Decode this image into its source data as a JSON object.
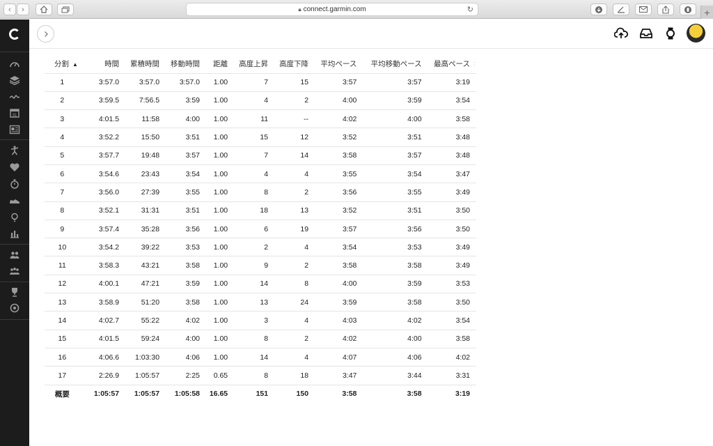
{
  "browser": {
    "url": "connect.garmin.com",
    "back_glyph": "‹",
    "forward_glyph": "›"
  },
  "sidebar": {
    "items": [
      {
        "icon": "dashboard-icon"
      },
      {
        "icon": "layers-icon"
      },
      {
        "icon": "activity-wave-icon"
      },
      {
        "icon": "calendar-icon"
      },
      {
        "icon": "news-icon"
      },
      {
        "icon": "run-person-icon"
      },
      {
        "icon": "heart-icon"
      },
      {
        "icon": "stopwatch-icon"
      },
      {
        "icon": "shoe-icon"
      },
      {
        "icon": "lightbulb-icon"
      },
      {
        "icon": "bar-chart-icon"
      },
      {
        "icon": "connections-icon"
      },
      {
        "icon": "groups-icon"
      },
      {
        "icon": "trophy-icon"
      },
      {
        "icon": "target-icon"
      }
    ]
  },
  "header": {
    "icons": [
      "upload-cloud-icon",
      "inbox-icon",
      "watch-icon",
      "avatar"
    ]
  },
  "table": {
    "columns": [
      "分割",
      "時間",
      "累積時間",
      "移動時間",
      "距離",
      "高度上昇",
      "高度下降",
      "平均ペース",
      "平均移動ペース",
      "最高ペース"
    ],
    "sort_indicator": "▲",
    "rows": [
      [
        "1",
        "3:57.0",
        "3:57.0",
        "3:57.0",
        "1.00",
        "7",
        "15",
        "3:57",
        "3:57",
        "3:19"
      ],
      [
        "2",
        "3:59.5",
        "7:56.5",
        "3:59",
        "1.00",
        "4",
        "2",
        "4:00",
        "3:59",
        "3:54"
      ],
      [
        "3",
        "4:01.5",
        "11:58",
        "4:00",
        "1.00",
        "11",
        "--",
        "4:02",
        "4:00",
        "3:58"
      ],
      [
        "4",
        "3:52.2",
        "15:50",
        "3:51",
        "1.00",
        "15",
        "12",
        "3:52",
        "3:51",
        "3:48"
      ],
      [
        "5",
        "3:57.7",
        "19:48",
        "3:57",
        "1.00",
        "7",
        "14",
        "3:58",
        "3:57",
        "3:48"
      ],
      [
        "6",
        "3:54.6",
        "23:43",
        "3:54",
        "1.00",
        "4",
        "4",
        "3:55",
        "3:54",
        "3:47"
      ],
      [
        "7",
        "3:56.0",
        "27:39",
        "3:55",
        "1.00",
        "8",
        "2",
        "3:56",
        "3:55",
        "3:49"
      ],
      [
        "8",
        "3:52.1",
        "31:31",
        "3:51",
        "1.00",
        "18",
        "13",
        "3:52",
        "3:51",
        "3:50"
      ],
      [
        "9",
        "3:57.4",
        "35:28",
        "3:56",
        "1.00",
        "6",
        "19",
        "3:57",
        "3:56",
        "3:50"
      ],
      [
        "10",
        "3:54.2",
        "39:22",
        "3:53",
        "1.00",
        "2",
        "4",
        "3:54",
        "3:53",
        "3:49"
      ],
      [
        "11",
        "3:58.3",
        "43:21",
        "3:58",
        "1.00",
        "9",
        "2",
        "3:58",
        "3:58",
        "3:49"
      ],
      [
        "12",
        "4:00.1",
        "47:21",
        "3:59",
        "1.00",
        "14",
        "8",
        "4:00",
        "3:59",
        "3:53"
      ],
      [
        "13",
        "3:58.9",
        "51:20",
        "3:58",
        "1.00",
        "13",
        "24",
        "3:59",
        "3:58",
        "3:50"
      ],
      [
        "14",
        "4:02.7",
        "55:22",
        "4:02",
        "1.00",
        "3",
        "4",
        "4:03",
        "4:02",
        "3:54"
      ],
      [
        "15",
        "4:01.5",
        "59:24",
        "4:00",
        "1.00",
        "8",
        "2",
        "4:02",
        "4:00",
        "3:58"
      ],
      [
        "16",
        "4:06.6",
        "1:03:30",
        "4:06",
        "1.00",
        "14",
        "4",
        "4:07",
        "4:06",
        "4:02"
      ],
      [
        "17",
        "2:26.9",
        "1:05:57",
        "2:25",
        "0.65",
        "8",
        "18",
        "3:47",
        "3:44",
        "3:31"
      ]
    ],
    "summary": [
      "概要",
      "1:05:57",
      "1:05:57",
      "1:05:58",
      "16.65",
      "151",
      "150",
      "3:58",
      "3:58",
      "3:19"
    ]
  },
  "colors": {
    "sidebar_bg": "#1c1c1c",
    "sidebar_icon": "#9a9a9a",
    "row_border": "#e5e5e5"
  }
}
